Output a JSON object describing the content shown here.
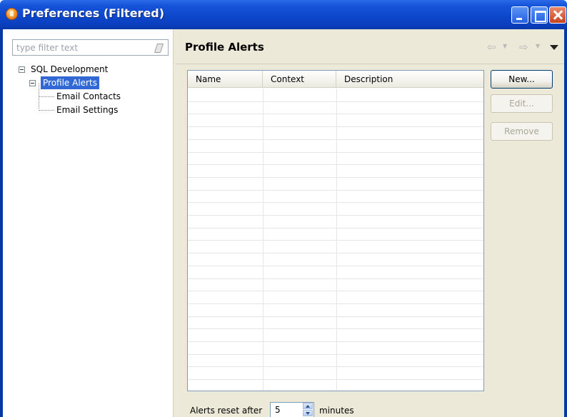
{
  "window": {
    "title": "Preferences (Filtered)"
  },
  "filter": {
    "placeholder": "type filter text",
    "value": ""
  },
  "tree": {
    "root": "SQL Development",
    "selected": "Profile Alerts",
    "children": [
      "Email Contacts",
      "Email Settings"
    ]
  },
  "page": {
    "title": "Profile Alerts"
  },
  "table": {
    "columns": [
      "Name",
      "Context",
      "Description"
    ],
    "rows": []
  },
  "buttons": {
    "new": "New...",
    "edit": "Edit...",
    "remove": "Remove"
  },
  "reset": {
    "label": "Alerts reset after",
    "value": "5",
    "unit": "minutes"
  },
  "colors": {
    "titlebar": "#0e47cc",
    "selection": "#3168d5",
    "pane_bg": "#ece9d8"
  }
}
